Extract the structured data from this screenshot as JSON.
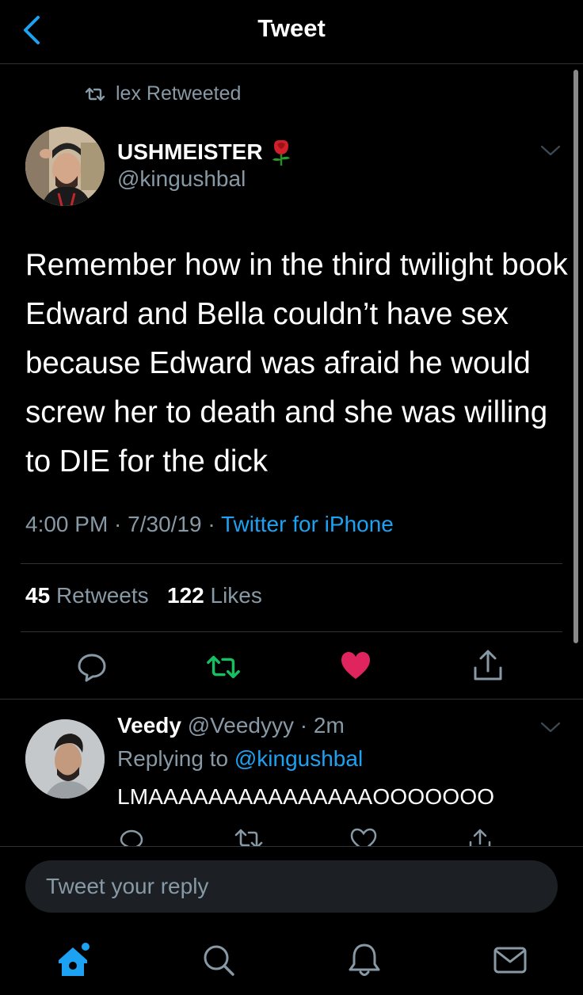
{
  "header": {
    "title": "Tweet"
  },
  "retweet_context": {
    "text": "lex Retweeted"
  },
  "tweet": {
    "author_name": "USHMEISTER",
    "author_handle": "@kingushbal",
    "text": "Remember how in the third twilight book Edward and Bella couldn’t have sex because Edward was afraid he would screw her to death and she was willing to DIE for the dick",
    "time": "4:00 PM",
    "date": "7/30/19",
    "source": "Twitter for iPhone",
    "meta_separator": " · ",
    "retweets_count": "45",
    "retweets_label": "Retweets",
    "likes_count": "122",
    "likes_label": "Likes",
    "liked": true,
    "name_emoji": "rose-icon"
  },
  "reply": {
    "author_name": "Veedy",
    "author_handle": "@Veedyyy",
    "age": "2m",
    "age_separator": " · ",
    "replying_to_label": "Replying to",
    "replying_to_handle": "@kingushbal",
    "text": "LMAAAAAAAAAAAAAAAOOOOOOO"
  },
  "composer": {
    "placeholder": "Tweet your reply"
  },
  "colors": {
    "accent": "#1da1f2",
    "like": "#e0245e",
    "retweet": "#17bf63",
    "muted": "#8899a6",
    "background": "#000000"
  }
}
